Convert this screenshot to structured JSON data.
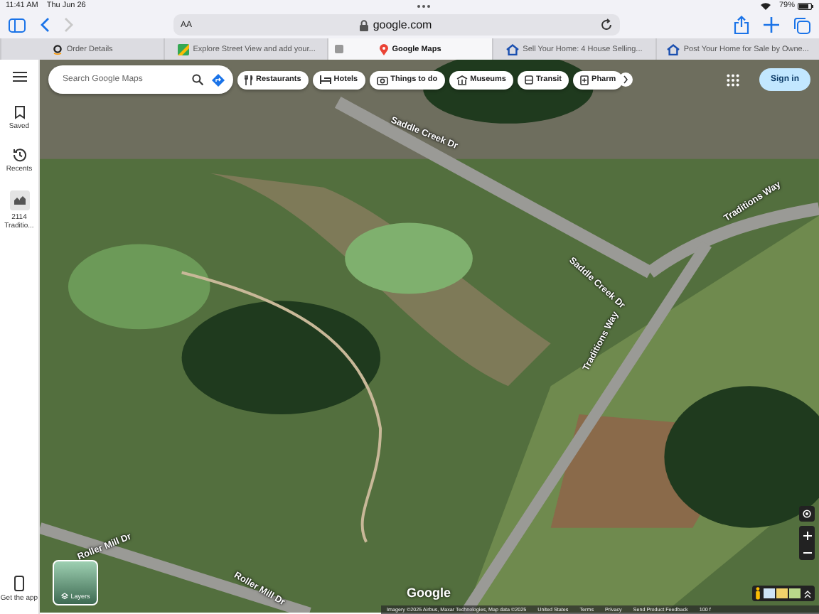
{
  "status_bar": {
    "time": "11:41 AM",
    "date": "Thu Jun 26",
    "battery": "79%"
  },
  "toolbar": {
    "text_size": "AA",
    "address": "google.com"
  },
  "tabs": [
    {
      "title": "Order Details",
      "selected": false
    },
    {
      "title": "Explore Street View and add your...",
      "selected": false
    },
    {
      "title": "Google Maps",
      "selected": true
    },
    {
      "title": "Sell Your Home: 4 House Selling...",
      "selected": false
    },
    {
      "title": "Post Your Home for Sale by Owne...",
      "selected": false
    }
  ],
  "sidebar": {
    "items": [
      {
        "label": "Saved",
        "kind": "saved"
      },
      {
        "label": "Recents",
        "kind": "recents"
      },
      {
        "label": "2114 Traditio...",
        "kind": "place"
      }
    ],
    "get_app": "Get the app"
  },
  "map": {
    "search": {
      "placeholder": "Search Google Maps"
    },
    "chips": [
      {
        "label": "Restaurants",
        "kind": "restaurant"
      },
      {
        "label": "Hotels",
        "kind": "hotel"
      },
      {
        "label": "Things to do",
        "kind": "camera"
      },
      {
        "label": "Museums",
        "kind": "museum"
      },
      {
        "label": "Transit",
        "kind": "transit"
      },
      {
        "label": "Pharm",
        "kind": "pharmacy"
      }
    ],
    "sign_in": "Sign in",
    "road_labels": [
      "Saddle Creek Dr",
      "Saddle Creek Dr",
      "Traditions Way",
      "Traditions Way",
      "Roller Mill Dr",
      "Roller Mill Dr"
    ],
    "layers": "Layers",
    "logo": "Google",
    "footer": [
      "Imagery ©2025 Airbus, Maxar Technologies, Map data ©2025",
      "United States",
      "Terms",
      "Privacy",
      "Send Product Feedback",
      "100 f"
    ]
  }
}
